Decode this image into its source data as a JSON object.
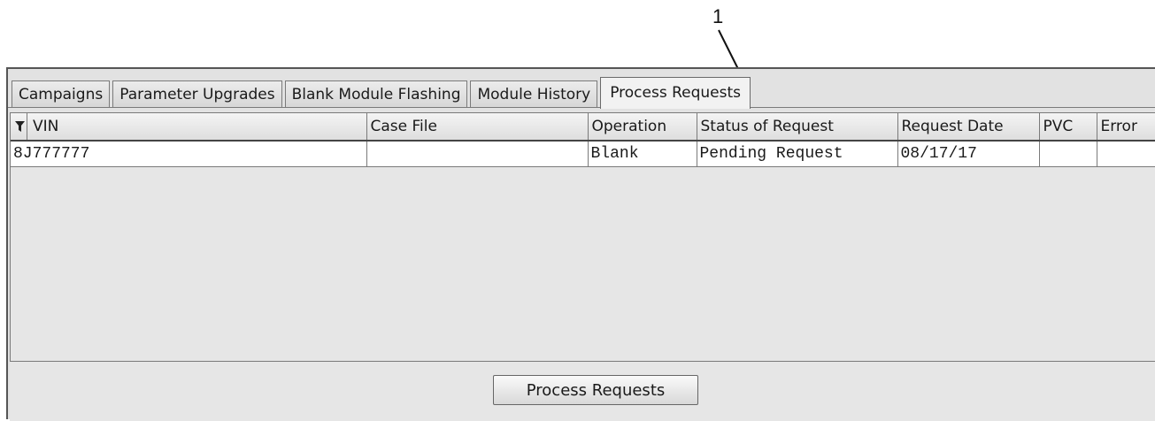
{
  "callout": {
    "number": "1"
  },
  "tabs": [
    {
      "label": "Campaigns",
      "active": false
    },
    {
      "label": "Parameter Upgrades",
      "active": false
    },
    {
      "label": "Blank Module Flashing",
      "active": false
    },
    {
      "label": "Module History",
      "active": false
    },
    {
      "label": "Process Requests",
      "active": true
    }
  ],
  "table": {
    "filter_icon": "filter-icon",
    "columns": [
      "VIN",
      "Case File",
      "Operation",
      "Status of Request",
      "Request Date",
      "PVC",
      "Error"
    ],
    "rows": [
      {
        "vin": "8J777777",
        "case_file": "",
        "operation": "Blank",
        "status": "Pending Request",
        "request_date": "08/17/17",
        "pvc": "",
        "error": ""
      }
    ]
  },
  "actions": {
    "process_label": "Process Requests"
  }
}
